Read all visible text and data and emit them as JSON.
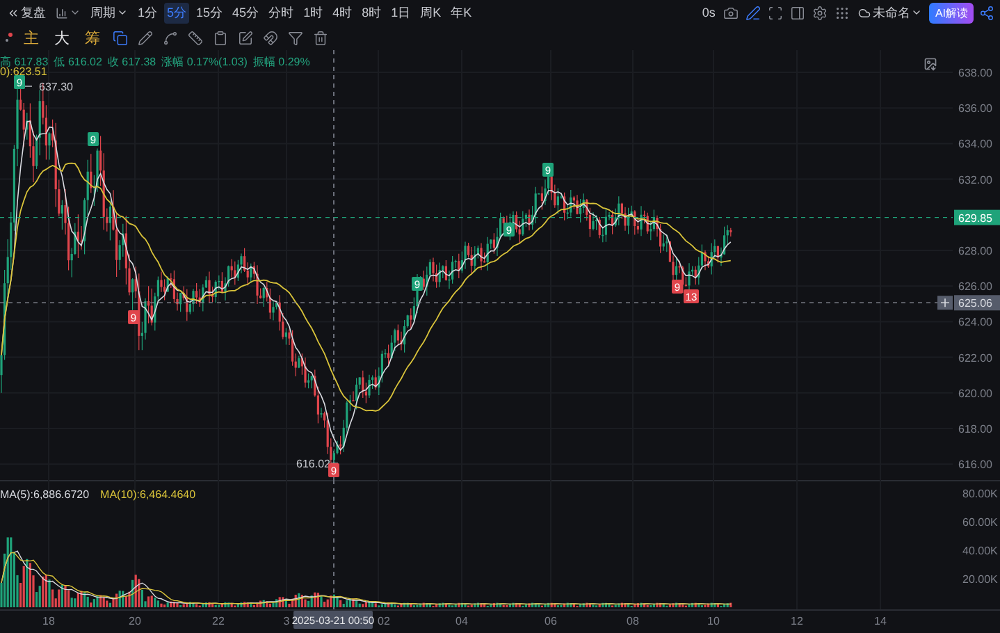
{
  "toolbar": {
    "replay": "复盘",
    "period": "周期",
    "intervals": [
      {
        "label": "1分",
        "selected": false
      },
      {
        "label": "5分",
        "selected": true
      },
      {
        "label": "15分",
        "selected": false
      },
      {
        "label": "45分",
        "selected": false
      },
      {
        "label": "分时",
        "selected": false
      },
      {
        "label": "1时",
        "selected": false
      },
      {
        "label": "4时",
        "selected": false
      },
      {
        "label": "8时",
        "selected": false
      },
      {
        "label": "1日",
        "selected": false
      },
      {
        "label": "周K",
        "selected": false
      },
      {
        "label": "年K",
        "selected": false
      }
    ],
    "timer": "0s",
    "layout_name": "未命名",
    "ai_button": "AI解读"
  },
  "indicator_tabs": [
    {
      "label": "主",
      "kind": "gold"
    },
    {
      "label": "大",
      "kind": "plain"
    },
    {
      "label": "筹",
      "kind": "gold"
    }
  ],
  "info_line": [
    {
      "label": "高",
      "value": "617.83"
    },
    {
      "label": "低",
      "value": "616.02"
    },
    {
      "label": "收",
      "value": "617.38"
    },
    {
      "label": "涨幅",
      "value": "0.17%(1.03)"
    },
    {
      "label": "振幅",
      "value": "0.29%"
    }
  ],
  "ma_legend": "0):623.51",
  "price_axis": [
    "638.00",
    "636.00",
    "634.00",
    "632.00",
    "628.00",
    "626.00",
    "624.00",
    "622.00",
    "620.00",
    "618.00",
    "616.00"
  ],
  "price_tags": [
    {
      "value": "629.85",
      "kind": "last"
    },
    {
      "value": "625.06",
      "kind": "crosshair"
    }
  ],
  "extreme_labels": [
    {
      "value": "637.30",
      "kind": "high"
    },
    {
      "value": "616.02",
      "kind": "low"
    }
  ],
  "signals": [
    {
      "text": "9",
      "kind": "up"
    },
    {
      "text": "9",
      "kind": "up"
    },
    {
      "text": "9",
      "kind": "down"
    },
    {
      "text": "9",
      "kind": "down"
    },
    {
      "text": "9",
      "kind": "up"
    },
    {
      "text": "9",
      "kind": "up"
    },
    {
      "text": "9",
      "kind": "up"
    },
    {
      "text": "9",
      "kind": "down"
    },
    {
      "text": "13",
      "kind": "down"
    }
  ],
  "volume": {
    "legend": [
      {
        "text": "MA(5):6,886.6720",
        "kind": "ma5"
      },
      {
        "text": "MA(10):6,464.4640",
        "kind": "ma10"
      }
    ],
    "axis": [
      "80.00K",
      "60.00K",
      "40.00K",
      "20.00K"
    ]
  },
  "time_axis": [
    "18",
    "20",
    "22",
    "3",
    "02",
    "04",
    "06",
    "08",
    "10",
    "12",
    "14"
  ],
  "crosshair_time": "2025-03-21 00:50"
}
